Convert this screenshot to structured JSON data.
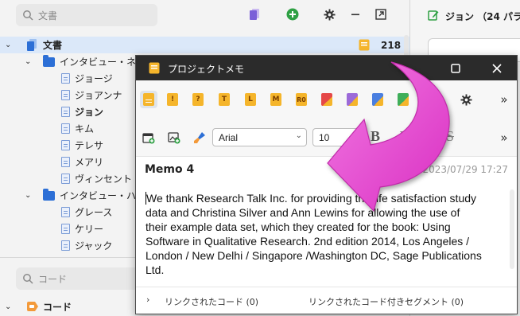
{
  "left_panel": {
    "search_placeholder": "文書",
    "code_search_placeholder": "コード",
    "tree": [
      {
        "label": "文書",
        "count": "218",
        "level": "root"
      },
      {
        "label": "インタビュー・ネ",
        "level": "folder"
      },
      {
        "label": "ジョージ",
        "level": "doc"
      },
      {
        "label": "ジョアンナ",
        "level": "doc"
      },
      {
        "label": "ジョン",
        "level": "doc",
        "bold": true
      },
      {
        "label": "キム",
        "level": "doc"
      },
      {
        "label": "テレサ",
        "level": "doc"
      },
      {
        "label": "メアリ",
        "level": "doc"
      },
      {
        "label": "ヴィンセント",
        "level": "doc"
      },
      {
        "label": "インタビュー・ハ",
        "level": "folder"
      },
      {
        "label": "グレース",
        "level": "doc"
      },
      {
        "label": "ケリー",
        "level": "doc"
      },
      {
        "label": "ジャック",
        "level": "doc"
      }
    ],
    "codes_label": "コード"
  },
  "right_panel": {
    "doc_header": "ジョン （24 パラ"
  },
  "memo_window": {
    "title": "プロジェクトメモ",
    "memo_title": "Memo 4",
    "memo_meta": "Max, 2023/07/29 17:27",
    "font_name": "Arial",
    "font_size": "10",
    "body_lines": [
      "We thank Research Talk Inc. for providing the life satisfaction study",
      "data and Christina Silver and Ann Lewins for allowing the use of",
      "their example data set, which they created for the book: Using",
      "Software in Qualitative Research. 2nd edition 2014, Los Angeles /",
      "London / New Delhi / Singapore /Washington DC, Sage Publications",
      "Ltd."
    ],
    "linked_codes": "リンクされたコード (0)",
    "linked_segments": "リンクされたコード付きセグメント (0)",
    "memo_types": [
      "",
      "!",
      "?",
      "T",
      "L",
      "M",
      "R0",
      "",
      "",
      "",
      "",
      ""
    ]
  },
  "colors": {
    "accent_pink": "#e83fd0",
    "memo_yellow": "#f5b52b",
    "titlebar": "#2b2b2b",
    "selection": "#dbe8f9",
    "folder_blue": "#2c6fd6"
  }
}
